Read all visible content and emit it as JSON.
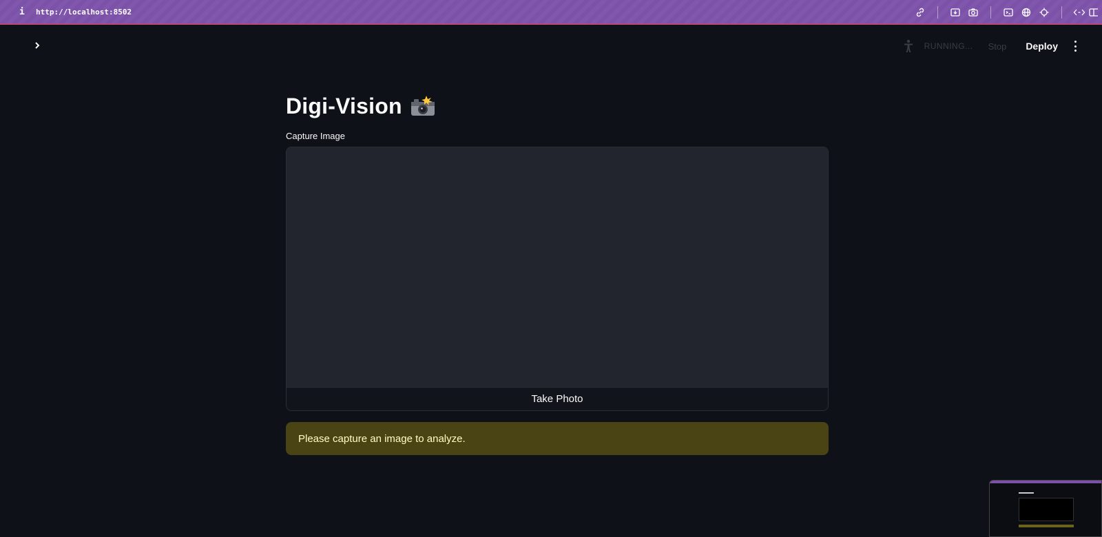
{
  "browser": {
    "info_icon": "i",
    "url": "http://localhost:8502",
    "icons": [
      "link-icon",
      "download-icon",
      "camera-icon",
      "terminal-icon",
      "globe-icon",
      "crosshair-icon",
      "code-icon",
      "split-view-icon"
    ]
  },
  "header": {
    "status": "RUNNING...",
    "stop_label": "Stop",
    "deploy_label": "Deploy"
  },
  "main": {
    "title": "Digi-Vision",
    "title_emoji_icon": "camera-flash-icon",
    "capture_label": "Capture Image",
    "take_photo_label": "Take Photo",
    "warning_text": "Please capture an image to analyze."
  },
  "colors": {
    "background": "#0e1117",
    "browser_bar": "#7b52a8",
    "warning_bg": "#4a4314",
    "warning_text": "#ffffc2"
  }
}
